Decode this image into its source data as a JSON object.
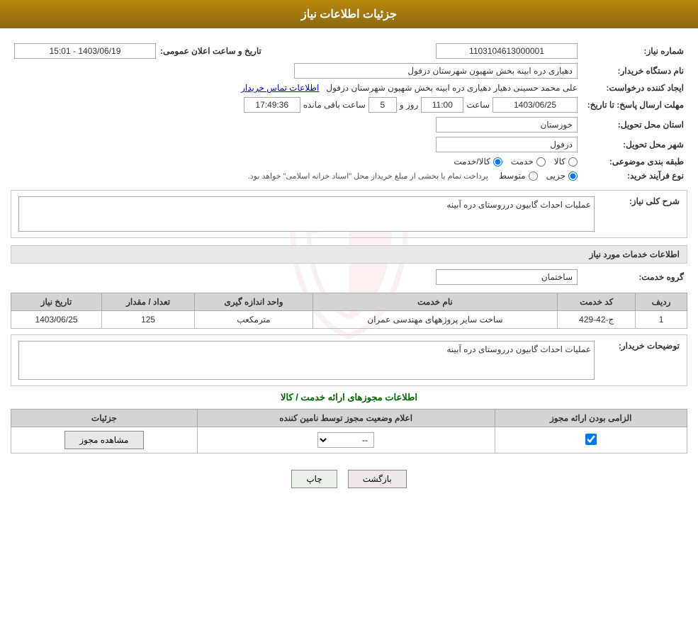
{
  "page": {
    "title": "جزئیات اطلاعات نیاز"
  },
  "header": {
    "announcement_label": "تاریخ و ساعت اعلان عمومی:",
    "announcement_value": "1403/06/19 - 15:01",
    "need_number_label": "شماره نیاز:",
    "need_number_value": "1103104613000001",
    "buyer_name_label": "نام دستگاه خریدار:",
    "buyer_name_value": "دهیاری دره ابینه بخش شهیون شهرستان دزفول",
    "requester_label": "ایجاد کننده درخواست:",
    "requester_value": "علی محمد حسینی دهیار دهیاری دره ابینه بخش شهیون شهرستان دزفول",
    "requester_link": "اطلاعات تماس خریدار",
    "deadline_label": "مهلت ارسال پاسخ: تا تاریخ:",
    "deadline_date": "1403/06/25",
    "deadline_time_label": "ساعت",
    "deadline_time": "11:00",
    "deadline_days_label": "روز و",
    "deadline_days": "5",
    "deadline_remaining_label": "ساعت باقی مانده",
    "deadline_remaining": "17:49:36",
    "province_label": "استان محل تحویل:",
    "province_value": "خوزستان",
    "city_label": "شهر محل تحویل:",
    "city_value": "دزفول",
    "category_label": "طبقه بندی موضوعی:",
    "category_options": [
      "کالا",
      "خدمت",
      "کالا/خدمت"
    ],
    "category_selected": "کالا",
    "purchase_type_label": "نوع فرآیند خرید:",
    "purchase_type_options": [
      "جزیی",
      "متوسط"
    ],
    "purchase_type_selected": "جزیی",
    "purchase_type_note": "پرداخت تمام یا بخشی از مبلغ خریداز محل \"اسناد خزانه اسلامی\" خواهد بود."
  },
  "need_description": {
    "section_title": "شرح کلی نیاز:",
    "value": "عملیات احداث گابیون درروستای دره آبینه"
  },
  "services_section": {
    "title": "اطلاعات خدمات مورد نیاز",
    "service_group_label": "گروه خدمت:",
    "service_group_value": "ساختمان",
    "table_headers": [
      "ردیف",
      "کد خدمت",
      "نام خدمت",
      "واحد اندازه گیری",
      "تعداد / مقدار",
      "تاریخ نیاز"
    ],
    "table_rows": [
      {
        "row": "1",
        "code": "ج-42-429",
        "name": "ساخت سایر پروژههای مهندسی عمران",
        "unit": "مترمکعب",
        "quantity": "125",
        "date": "1403/06/25"
      }
    ]
  },
  "buyer_description": {
    "label": "توضیحات خریدار:",
    "value": "عملیات احداث گابیون درروستای دره آبینه"
  },
  "license_section": {
    "title": "اطلاعات مجوزهای ارائه خدمت / کالا",
    "table_headers": [
      "الزامی بودن ارائه مجوز",
      "اعلام وضعیت مجوز توسط نامین کننده",
      "جزئیات"
    ],
    "table_rows": [
      {
        "required": true,
        "status": "--",
        "details_label": "مشاهده مجوز"
      }
    ]
  },
  "buttons": {
    "print": "چاپ",
    "back": "بازگشت"
  }
}
